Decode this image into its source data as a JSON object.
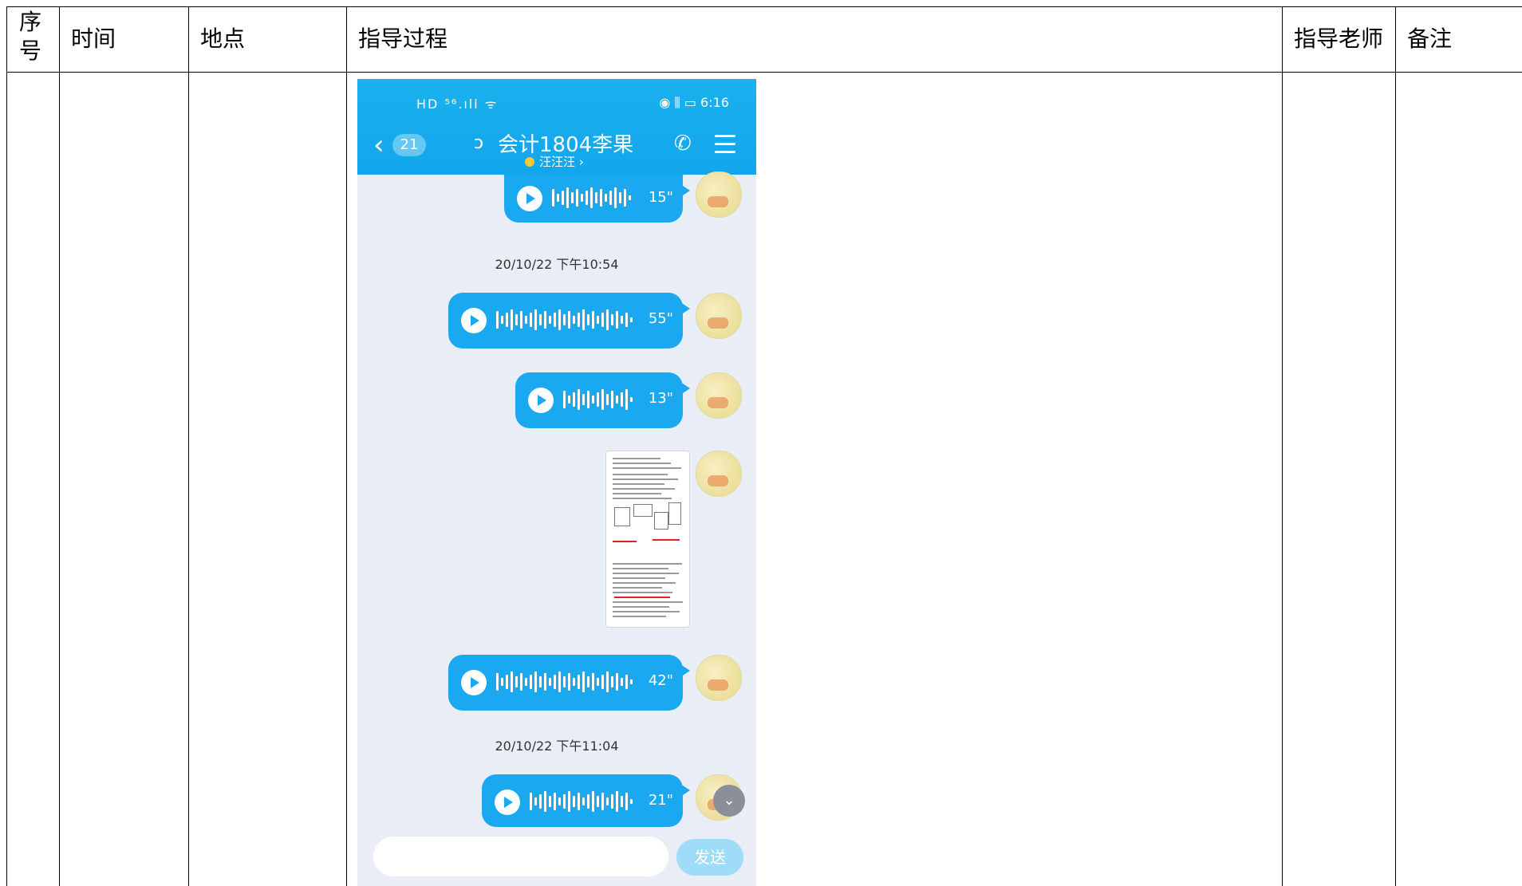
{
  "table": {
    "headers": {
      "index": [
        "序",
        "号"
      ],
      "time": "时间",
      "location": "地点",
      "process": "指导过程",
      "teacher": "指导老师",
      "remarks": "备注"
    }
  },
  "phone": {
    "status_bar": {
      "left_icons": "HD ⁵⁶.ıll ᯤ",
      "right_text": "◉ ⫼ ▭ 6:16"
    },
    "header": {
      "back_icon": "chevron-left-icon",
      "unread_count": "21",
      "title": "会计1804李果",
      "subtitle": "汪汪汪 ›",
      "icons": [
        "ear-icon",
        "phone-icon",
        "menu-icon"
      ]
    },
    "messages": [
      {
        "type": "voice",
        "duration": "15\""
      },
      {
        "type": "timestamp",
        "text": "20/10/22 下午10:54"
      },
      {
        "type": "voice",
        "duration": "55\""
      },
      {
        "type": "voice",
        "duration": "13\""
      },
      {
        "type": "image",
        "content": "document-screenshot"
      },
      {
        "type": "voice",
        "duration": "42\""
      },
      {
        "type": "timestamp",
        "text": "20/10/22 下午11:04"
      },
      {
        "type": "voice",
        "duration": "21\""
      }
    ],
    "input": {
      "placeholder": "",
      "send_label": "发送"
    },
    "colors": {
      "accent": "#1aa9f0",
      "background": "#e9edf6"
    }
  }
}
